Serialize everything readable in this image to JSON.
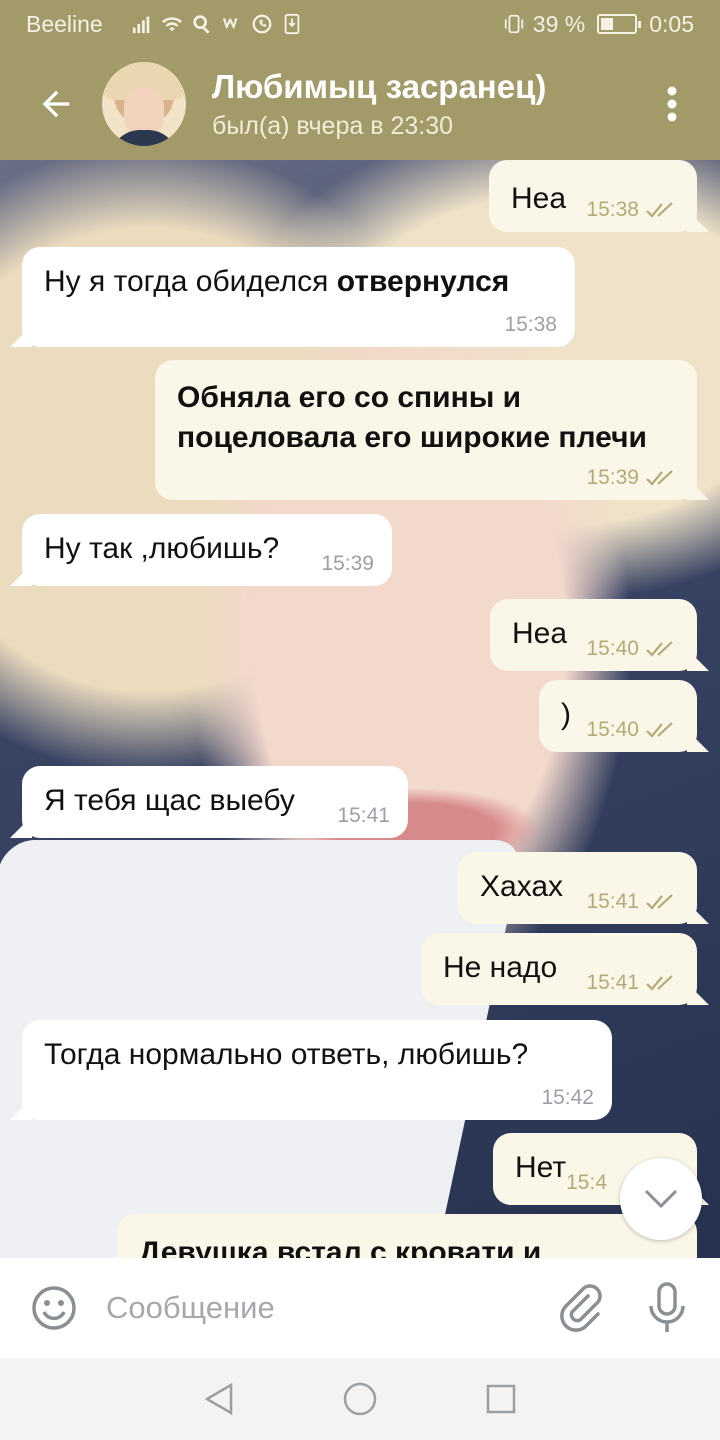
{
  "status_bar": {
    "carrier": "Beeline",
    "battery_text": "39 %",
    "battery_level": 0.39,
    "time": "0:05"
  },
  "header": {
    "title": "Любимыц засранец)",
    "status": "был(а) вчера в 23:30"
  },
  "messages": [
    {
      "dir": "out",
      "text": "Неа",
      "time": "15:38",
      "read": true
    },
    {
      "dir": "in",
      "text": "Ну я тогда обиделся ",
      "bold": "отвернулся",
      "time": "15:38"
    },
    {
      "dir": "out",
      "text_bold_lines": [
        "Обняла его со спины и",
        "поцеловала его широкие плечи"
      ],
      "time": "15:39",
      "read": true
    },
    {
      "dir": "in",
      "text": "Ну так ,любишь?",
      "time": "15:39"
    },
    {
      "dir": "out",
      "text": "Неа",
      "time": "15:40",
      "read": true
    },
    {
      "dir": "out",
      "text": ")",
      "time": "15:40",
      "read": true
    },
    {
      "dir": "in",
      "text": "Я тебя щас выебу",
      "time": "15:41"
    },
    {
      "dir": "out",
      "text": "Хахах",
      "time": "15:41",
      "read": true
    },
    {
      "dir": "out",
      "text": "Не надо",
      "time": "15:41",
      "read": true
    },
    {
      "dir": "in",
      "text": "Тогда нормально ответь, любишь?",
      "time": "15:42"
    },
    {
      "dir": "out",
      "text": "Нет",
      "time": "15:4",
      "read": true
    },
    {
      "dir": "out",
      "text": "Девушка встал с кровати и",
      "bold_whole": true
    }
  ],
  "input": {
    "placeholder": "Сообщение"
  },
  "icons": {
    "back": "arrow-left-icon",
    "menu": "more-vertical-icon",
    "emoji": "smiley-icon",
    "attach": "paperclip-icon",
    "mic": "microphone-icon",
    "scroll": "chevron-down-icon",
    "read": "double-check-icon"
  },
  "colors": {
    "header": "#a29a68",
    "outgoing_bubble": "#fbf7e8",
    "incoming_bubble": "#ffffff",
    "check": "#b4a977"
  }
}
